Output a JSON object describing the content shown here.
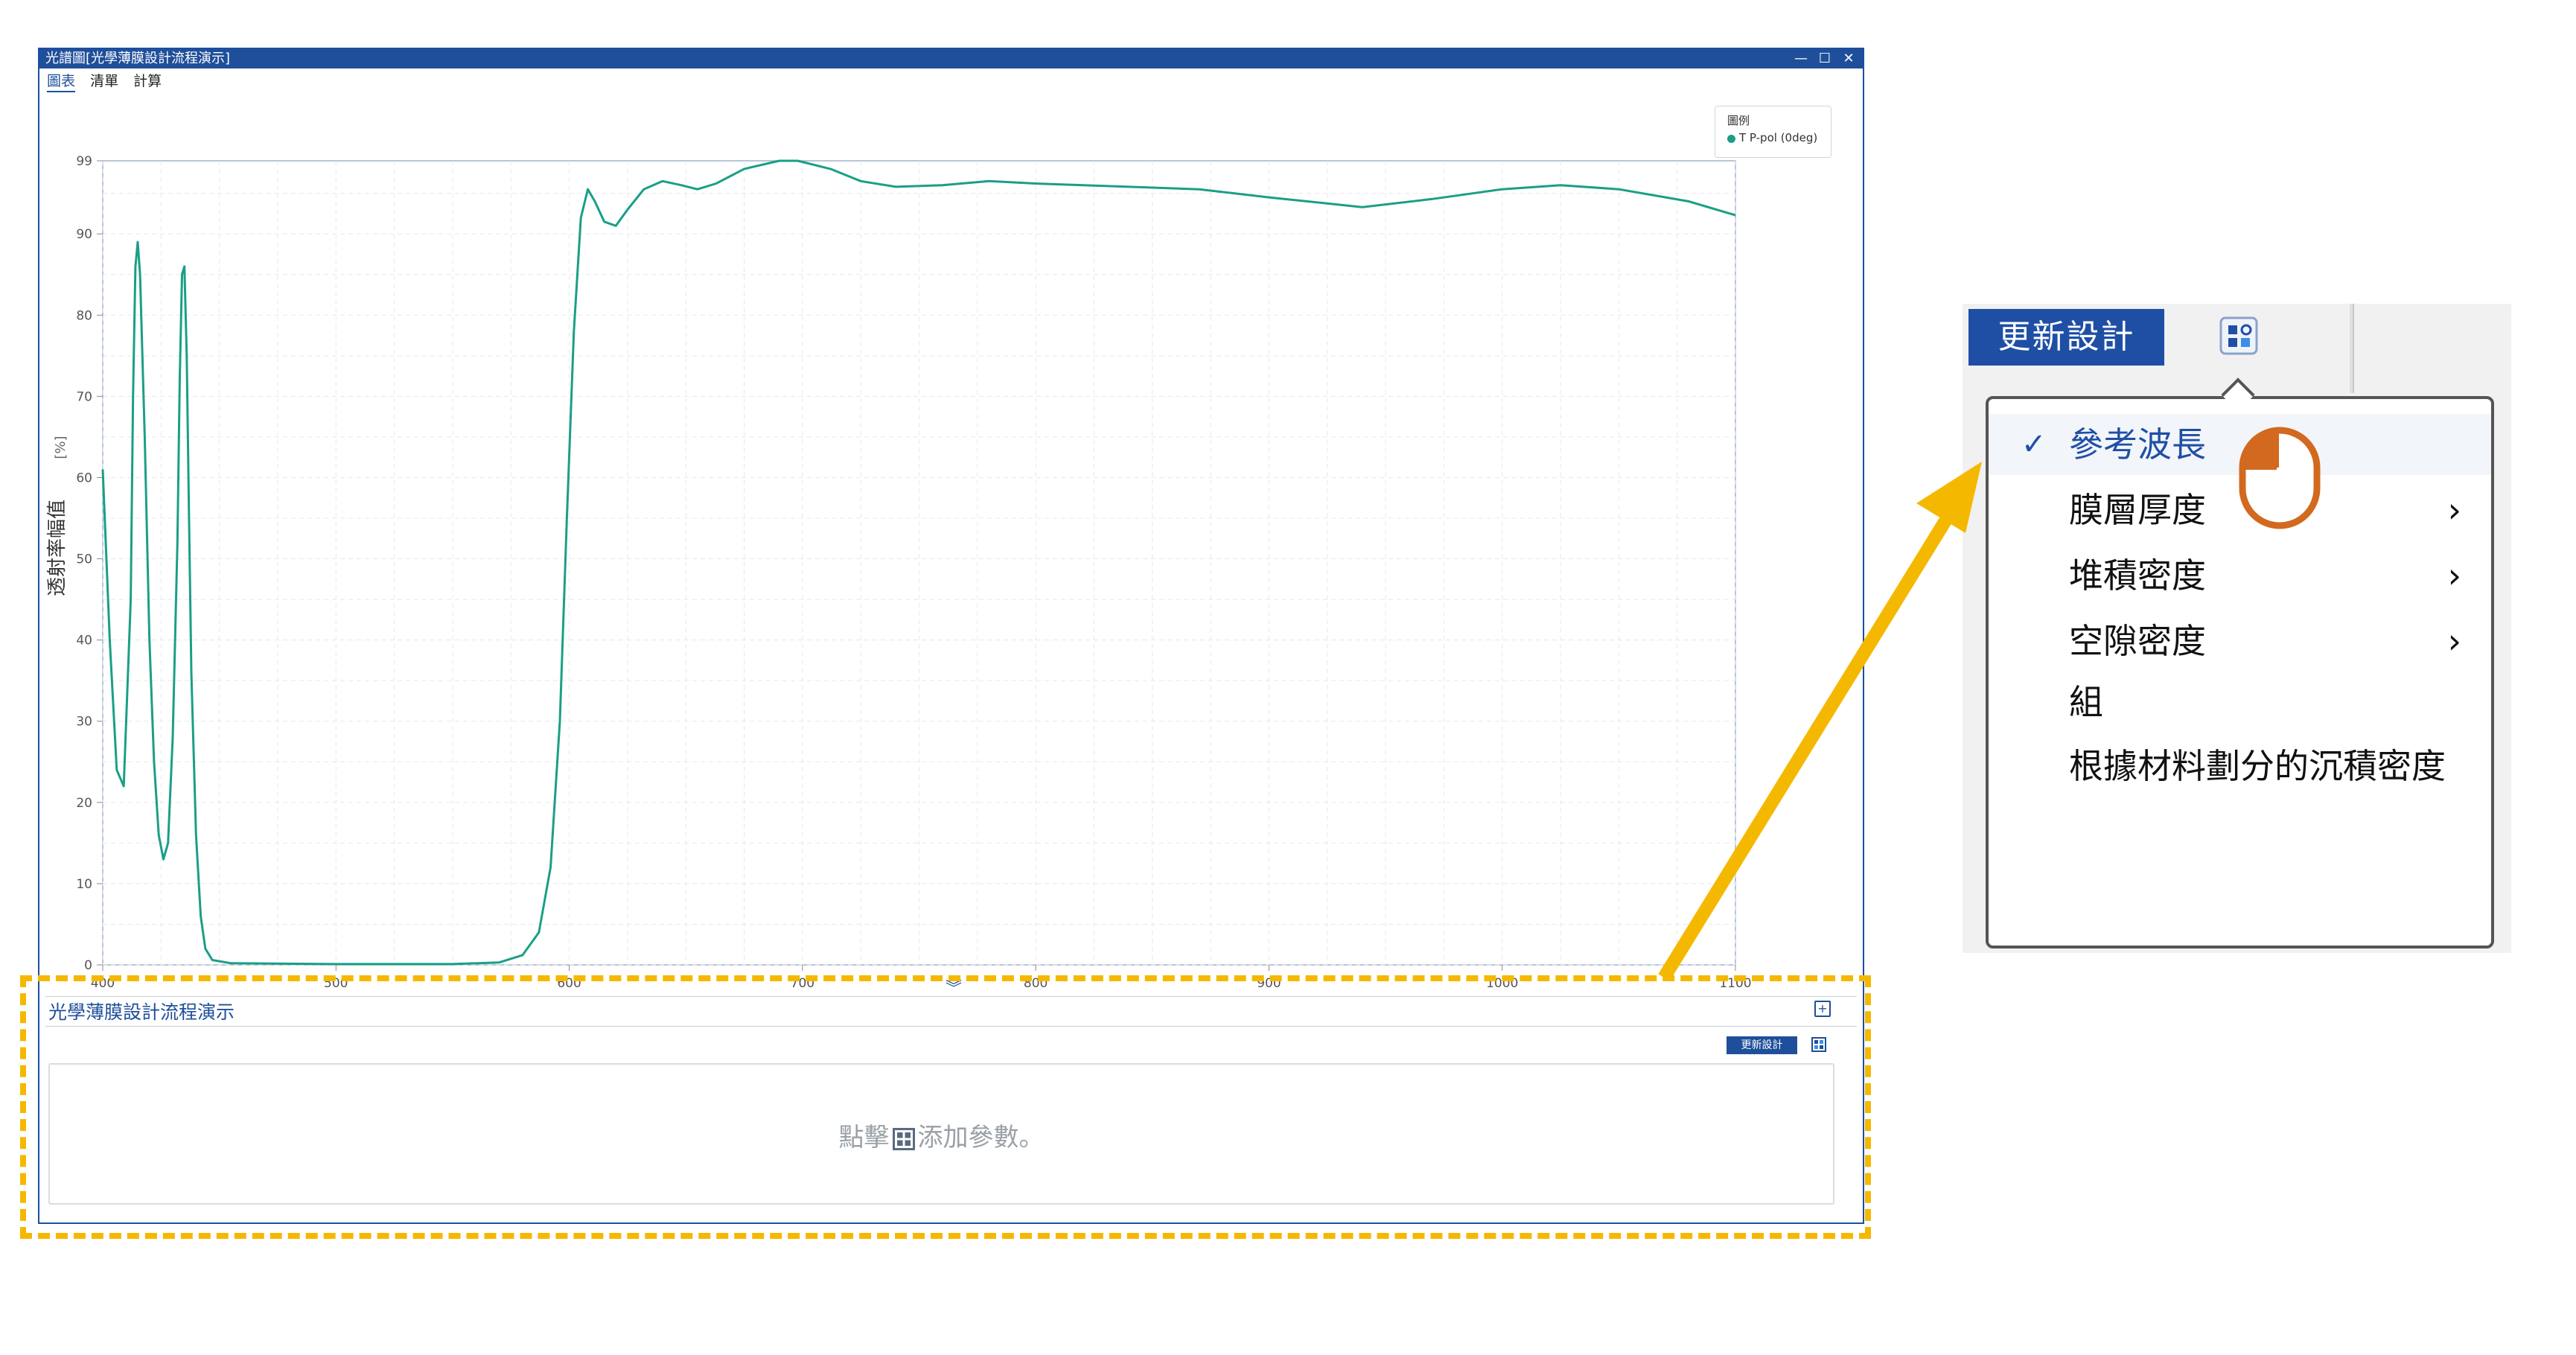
{
  "window": {
    "title": "光譜圖[光學薄膜設計流程演示]",
    "controls": [
      "—",
      "☐",
      "✕"
    ],
    "tabs": [
      "圖表",
      "清單",
      "計算"
    ],
    "active_tab": "圖表"
  },
  "chart_data": {
    "type": "line",
    "xlabel": "波長[nm]",
    "ylabel": "透射率幅值",
    "ylabel_unit": "[%]",
    "xlim": [
      400,
      1100
    ],
    "ylim": [
      0,
      99
    ],
    "x_ticks": [
      400,
      500,
      600,
      700,
      800,
      900,
      1000,
      1100
    ],
    "y_ticks": [
      0,
      10,
      20,
      30,
      40,
      50,
      60,
      70,
      80,
      90,
      99
    ],
    "grid": true,
    "legend_title": "圖例",
    "legend_placement": "top-right",
    "series": [
      {
        "name": "T P-pol (0deg)",
        "color": "#1a9f86",
        "points": [
          [
            400,
            61
          ],
          [
            403,
            40
          ],
          [
            406,
            24
          ],
          [
            409,
            22
          ],
          [
            412,
            45
          ],
          [
            413,
            70
          ],
          [
            414,
            86
          ],
          [
            415,
            89
          ],
          [
            416,
            85
          ],
          [
            418,
            65
          ],
          [
            420,
            40
          ],
          [
            422,
            25
          ],
          [
            424,
            16
          ],
          [
            426,
            13
          ],
          [
            428,
            15
          ],
          [
            430,
            28
          ],
          [
            432,
            52
          ],
          [
            433,
            72
          ],
          [
            434,
            85
          ],
          [
            435,
            86
          ],
          [
            436,
            75
          ],
          [
            437,
            55
          ],
          [
            438,
            36
          ],
          [
            440,
            16
          ],
          [
            442,
            6
          ],
          [
            444,
            2
          ],
          [
            447,
            0.6
          ],
          [
            455,
            0.2
          ],
          [
            500,
            0.1
          ],
          [
            550,
            0.1
          ],
          [
            570,
            0.3
          ],
          [
            580,
            1.2
          ],
          [
            587,
            4
          ],
          [
            592,
            12
          ],
          [
            596,
            30
          ],
          [
            599,
            55
          ],
          [
            602,
            78
          ],
          [
            605,
            92
          ],
          [
            608,
            95.5
          ],
          [
            611,
            94
          ],
          [
            615,
            91.5
          ],
          [
            620,
            91
          ],
          [
            625,
            93
          ],
          [
            632,
            95.5
          ],
          [
            640,
            96.5
          ],
          [
            648,
            96
          ],
          [
            655,
            95.5
          ],
          [
            663,
            96.2
          ],
          [
            675,
            98
          ],
          [
            690,
            99
          ],
          [
            698,
            99
          ],
          [
            712,
            98
          ],
          [
            725,
            96.5
          ],
          [
            740,
            95.8
          ],
          [
            760,
            96
          ],
          [
            780,
            96.5
          ],
          [
            800,
            96.2
          ],
          [
            840,
            95.8
          ],
          [
            870,
            95.5
          ],
          [
            900,
            94.5
          ],
          [
            940,
            93.3
          ],
          [
            970,
            94.3
          ],
          [
            1000,
            95.5
          ],
          [
            1025,
            96
          ],
          [
            1050,
            95.5
          ],
          [
            1080,
            94
          ],
          [
            1100,
            92.3
          ]
        ]
      }
    ]
  },
  "panel": {
    "collapse_glyph": "︾",
    "title": "光學薄膜設計流程演示",
    "expand_glyph": "+",
    "update_label": "更新設計",
    "hint_before": "點擊",
    "hint_after": "添加參數。"
  },
  "callout": {
    "update_label": "更新設計",
    "menu_items": [
      {
        "label": "參考波長",
        "checked": true,
        "submenu": false
      },
      {
        "label": "膜層厚度",
        "checked": false,
        "submenu": true
      },
      {
        "label": "堆積密度",
        "checked": false,
        "submenu": true
      },
      {
        "label": "空隙密度",
        "checked": false,
        "submenu": true
      },
      {
        "label": "組",
        "checked": false,
        "submenu": false
      },
      {
        "label": "根據材料劃分的沉積密度",
        "checked": false,
        "submenu": false
      }
    ],
    "check_glyph": "✓",
    "submenu_glyph": "›"
  },
  "colors": {
    "brand_blue": "#1f4f9a",
    "series": "#1a9f86",
    "highlight": "#f5b800",
    "cursor": "#d2691e"
  },
  "icons": [
    "grid-param-icon",
    "mouse-cursor-icon",
    "check-icon",
    "chevron-right-icon",
    "expand-icon",
    "collapse-icon"
  ]
}
